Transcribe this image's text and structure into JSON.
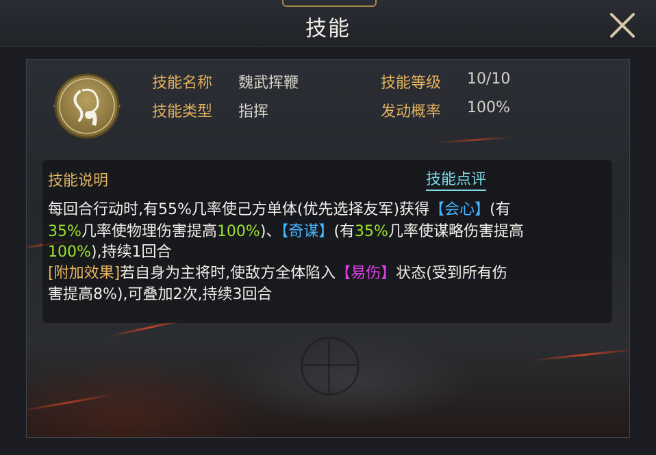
{
  "header": {
    "title": "技能"
  },
  "skill": {
    "name_label": "技能名称",
    "name_value": "魏武挥鞭",
    "level_label": "技能等级",
    "level_value": "10/10",
    "type_label": "技能类型",
    "type_value": "指挥",
    "chance_label": "发动概率",
    "chance_value": "100%"
  },
  "description": {
    "heading": "技能说明",
    "review_link": "技能点评",
    "line1": {
      "a": "每回合行动时,有55%几率使己方单体(优先选择友军)获得",
      "b": "【会心】",
      "c": "(有"
    },
    "line2": {
      "a": "35%",
      "b": "几率使物理伤害提高",
      "c": "100%",
      "d": ")、",
      "e": "【奇谋】",
      "f": "(有",
      "g": "35%",
      "h": "几率使谋略伤害提高"
    },
    "line3": {
      "a": "100%",
      "b": "),持续1回合"
    },
    "line4": {
      "a": "[附加效果]",
      "b": "若自身为主将时,使敌方全体陷入",
      "c": "【易伤】",
      "d": "状态(受到所有伤"
    },
    "line5": {
      "a": "害提高8%),可叠加2次,持续3回合"
    }
  },
  "colors": {
    "label_gold": "#e4b35d",
    "highlight_green": "#9be22e",
    "highlight_blue": "#45b4ff",
    "highlight_magenta": "#e040e8",
    "link_cyan": "#7fd9e8"
  },
  "icons": {
    "close": "close-x-icon",
    "skill": "whip-skill-icon"
  }
}
